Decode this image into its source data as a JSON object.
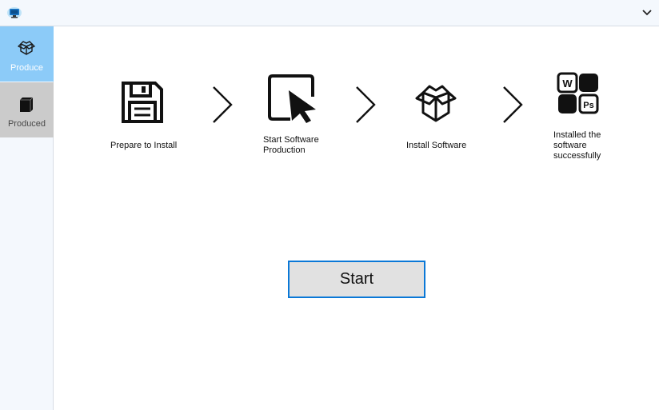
{
  "titlebar": {
    "app_icon": "monitor-cloud-icon",
    "collapse_icon": "chevron-down-icon"
  },
  "sidebar": {
    "items": [
      {
        "label": "Produce",
        "icon": "open-box-icon",
        "active": true
      },
      {
        "label": "Produced",
        "icon": "closed-box-icon",
        "active": false
      }
    ]
  },
  "steps": [
    {
      "label": "Prepare to Install",
      "icon": "floppy-disk-icon"
    },
    {
      "label": "Start Software Production",
      "icon": "cursor-icon"
    },
    {
      "label": "Install Software",
      "icon": "open-box-icon"
    },
    {
      "label": "Installed the software successfully",
      "icon": "apps-grid-icon"
    }
  ],
  "actions": {
    "start_label": "Start"
  },
  "colors": {
    "sidebar_active": "#8ccbf8",
    "sidebar_inactive": "#cbcbcb",
    "button_border": "#0a78d7",
    "button_fill": "#e1e1e1"
  }
}
